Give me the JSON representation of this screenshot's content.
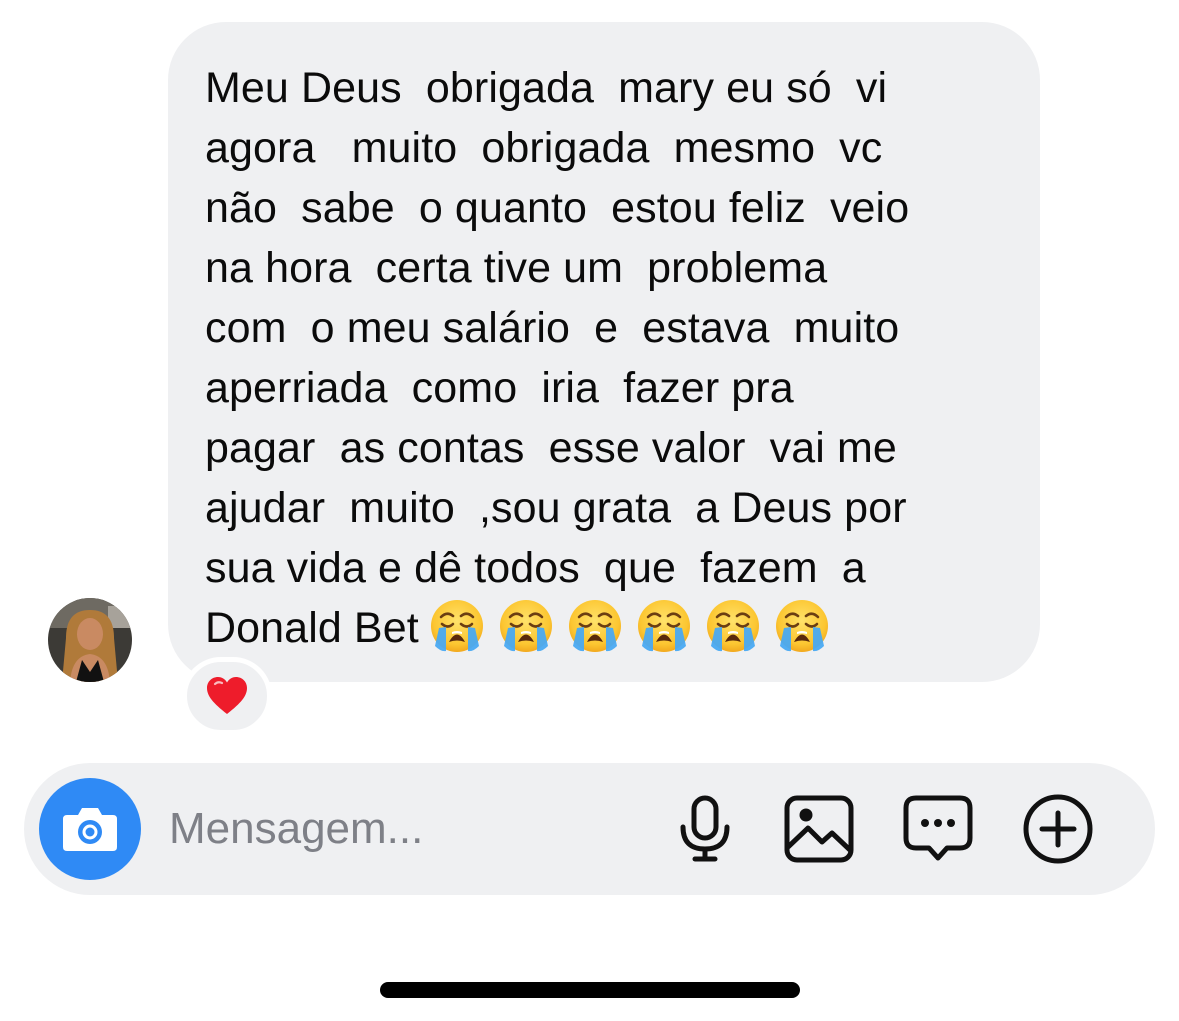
{
  "message": {
    "lines": [
      "Meu Deus  obrigada  mary eu só  vi",
      "agora   muito  obrigada  mesmo  vc",
      "não  sabe  o quanto  estou feliz  veio",
      "na hora  certa tive um  problema",
      "com  o meu salário  e  estava  muito",
      "aperriada  como  iria  fazer pra",
      "pagar  as contas  esse valor  vai me",
      "ajudar  muito  ,sou grata  a Deus por",
      "sua vida e dê todos  que  fazem  a",
      "Donald Bet"
    ],
    "trailing_emojis": [
      "loudly-crying-face",
      "loudly-crying-face",
      "loudly-crying-face",
      "loudly-crying-face",
      "loudly-crying-face",
      "loudly-crying-face"
    ],
    "reaction": "red-heart",
    "bubble_color": "#eff0f2"
  },
  "sender": {
    "avatar_icon": "profile-photo"
  },
  "composer": {
    "placeholder": "Mensagem...",
    "value": "",
    "camera_color": "#2f8af5",
    "actions": [
      "microphone-icon",
      "gallery-icon",
      "chat-options-icon",
      "add-icon"
    ]
  }
}
